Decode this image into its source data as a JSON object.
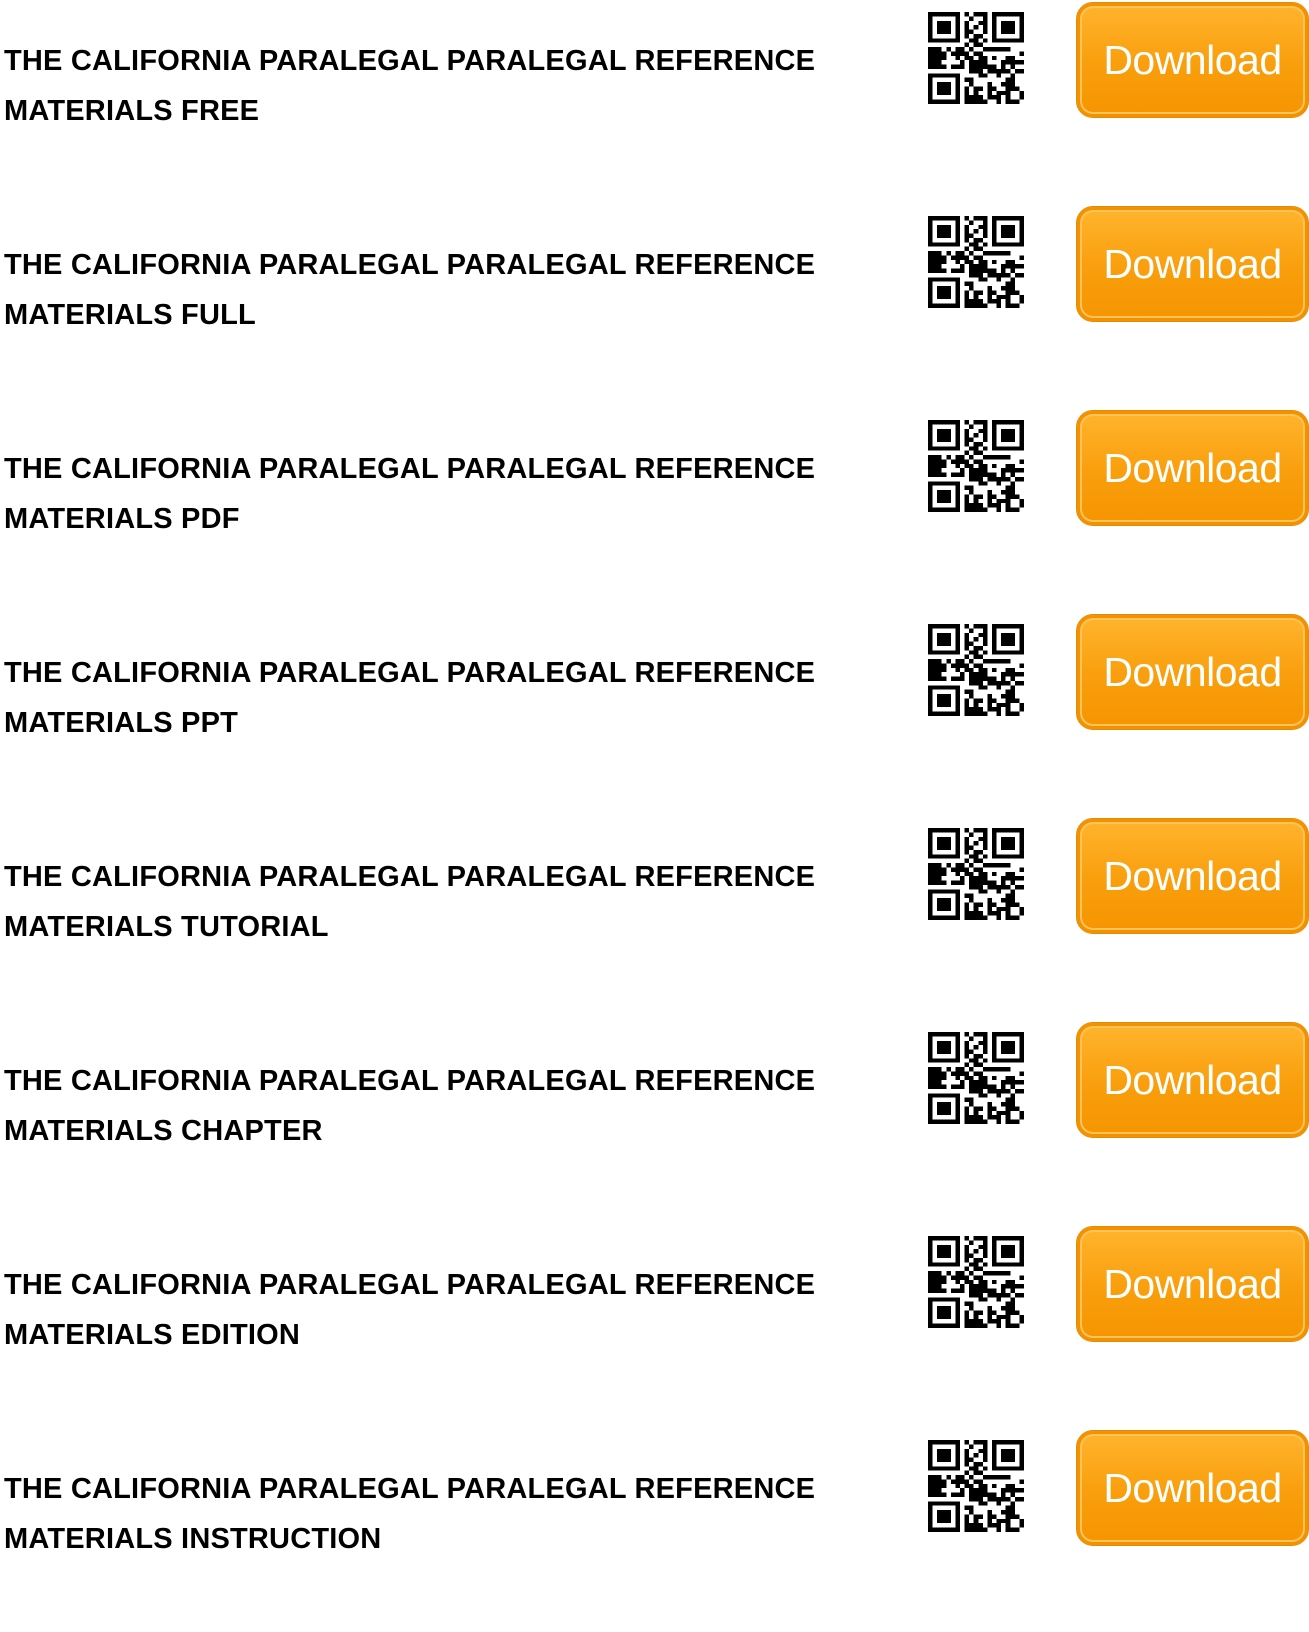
{
  "items": [
    {
      "line1": "THE CALIFORNIA PARALEGAL PARALEGAL REFERENCE",
      "line2": "MATERIALS FREE",
      "button_label": "Download",
      "qr_icon": "qr-code-icon"
    },
    {
      "line1": "THE CALIFORNIA PARALEGAL PARALEGAL REFERENCE",
      "line2": "MATERIALS FULL",
      "button_label": "Download",
      "qr_icon": "qr-code-icon"
    },
    {
      "line1": "THE CALIFORNIA PARALEGAL PARALEGAL REFERENCE",
      "line2": "MATERIALS PDF",
      "button_label": "Download",
      "qr_icon": "qr-code-icon"
    },
    {
      "line1": "THE CALIFORNIA PARALEGAL PARALEGAL REFERENCE",
      "line2": "MATERIALS PPT",
      "button_label": "Download",
      "qr_icon": "qr-code-icon"
    },
    {
      "line1": "THE CALIFORNIA PARALEGAL PARALEGAL REFERENCE",
      "line2": "MATERIALS TUTORIAL",
      "button_label": "Download",
      "qr_icon": "qr-code-icon"
    },
    {
      "line1": "THE CALIFORNIA PARALEGAL PARALEGAL REFERENCE",
      "line2": "MATERIALS CHAPTER",
      "button_label": "Download",
      "qr_icon": "qr-code-icon"
    },
    {
      "line1": "THE CALIFORNIA PARALEGAL PARALEGAL REFERENCE",
      "line2": "MATERIALS EDITION",
      "button_label": "Download",
      "qr_icon": "qr-code-icon"
    },
    {
      "line1": "THE CALIFORNIA PARALEGAL PARALEGAL REFERENCE",
      "line2": "MATERIALS INSTRUCTION",
      "button_label": "Download",
      "qr_icon": "qr-code-icon"
    }
  ],
  "colors": {
    "button_orange": "#f99e0c",
    "button_text": "#ffffff",
    "title_text": "#000000",
    "background": "#ffffff"
  }
}
